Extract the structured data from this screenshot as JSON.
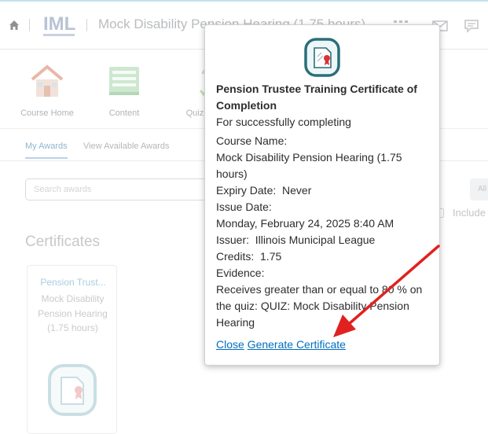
{
  "header": {
    "course_title": "Mock Disability Pension Hearing (1.75 hours)",
    "logo_text": "IML"
  },
  "nav_tiles": [
    {
      "label": "Course Home",
      "icon": "house-icon"
    },
    {
      "label": "Content",
      "icon": "book-icon"
    },
    {
      "label": "Quiz",
      "icon": "quiz-icon"
    }
  ],
  "tabs": [
    {
      "label": "My Awards",
      "active": true
    },
    {
      "label": "View Available Awards",
      "active": false
    }
  ],
  "search": {
    "placeholder": "Search awards"
  },
  "filter": {
    "all_label": "All",
    "include_label": "Include"
  },
  "certificates": {
    "heading": "Certificates",
    "card": {
      "title": "Pension Trust...",
      "course": "Mock Disability Pension Hearing (1.75 hours)"
    }
  },
  "popup": {
    "title": "Pension Trustee Training Certificate of Completion",
    "subtitle": "For successfully completing",
    "course_label": "Course Name:",
    "course_value": "Mock Disability Pension Hearing (1.75 hours)",
    "expiry_label": "Expiry Date:",
    "expiry_value": "Never",
    "issue_label": "Issue Date:",
    "issue_value": "Monday, February 24, 2025 8:40 AM",
    "issuer_label": "Issuer:",
    "issuer_value": "Illinois Municipal League",
    "credits_label": "Credits:",
    "credits_value": "1.75",
    "evidence_label": "Evidence:",
    "evidence_value": "Receives greater than or equal to 80 % on the quiz: QUIZ: Mock Disability Pension Hearing",
    "close_link": "Close",
    "generate_link": "Generate Certificate"
  },
  "colors": {
    "link": "#006fbf",
    "annotation_arrow": "#e0211f",
    "certificate_icon": "#2a6f7a"
  }
}
